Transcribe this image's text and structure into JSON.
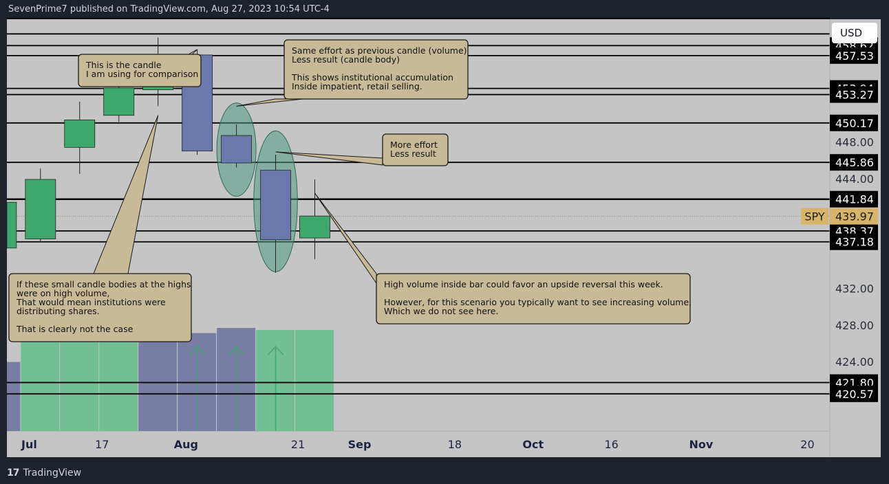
{
  "header": {
    "publish_line": "SevenPrime7 published on TradingView.com, Aug 27, 2023 10:54 UTC-4"
  },
  "footer": {
    "brand": "TradingView",
    "logo_glyph": "17"
  },
  "currency": "USD",
  "symbol_tag": {
    "text": "SPY",
    "price": "439.97"
  },
  "colors": {
    "background": "#c5c5c5",
    "frame": "#1e222d",
    "bull": "#3ea86c",
    "bear": "#6b78ac",
    "callout": "#c8ba96",
    "ellipse": "#4f9b85"
  },
  "chart_data": {
    "type": "candlestick",
    "symbol": "SPY",
    "ylim": [
      416.5,
      461.5
    ],
    "xlim": [
      "2023-06-30",
      "2023-11-24"
    ],
    "y_ticks": [
      "448.00",
      "444.00",
      "432.00",
      "428.00",
      "424.00"
    ],
    "x_ticks": [
      {
        "label": "Jul",
        "date": "2023-07-03"
      },
      {
        "label": "17",
        "date": "2023-07-17"
      },
      {
        "label": "Aug",
        "date": "2023-08-01"
      },
      {
        "label": "21",
        "date": "2023-08-21"
      },
      {
        "label": "Sep",
        "date": "2023-09-01"
      },
      {
        "label": "18",
        "date": "2023-09-18"
      },
      {
        "label": "Oct",
        "date": "2023-10-02"
      },
      {
        "label": "16",
        "date": "2023-10-16"
      },
      {
        "label": "Nov",
        "date": "2023-11-01"
      },
      {
        "label": "20",
        "date": "2023-11-20"
      }
    ],
    "level_labels": [
      "458.62",
      "457.53",
      "453.94",
      "453.27",
      "450.17",
      "445.86",
      "441.84",
      "438.37",
      "437.18",
      "421.80",
      "420.57"
    ],
    "horizontal_levels": [
      461.6,
      459.9,
      458.62,
      457.53,
      453.94,
      453.27,
      450.17,
      445.86,
      441.84,
      438.37,
      437.18,
      421.8,
      420.57
    ],
    "last_price": 439.97,
    "candles": [
      {
        "date": "2023-06-26",
        "open": 436.5,
        "high": 444.0,
        "low": 436.5,
        "close": 441.5
      },
      {
        "date": "2023-07-03",
        "open": 437.5,
        "high": 445.2,
        "low": 437.2,
        "close": 444.0
      },
      {
        "date": "2023-07-10",
        "open": 447.5,
        "high": 452.5,
        "low": 444.6,
        "close": 450.5
      },
      {
        "date": "2023-07-17",
        "open": 451.0,
        "high": 456.5,
        "low": 450.3,
        "close": 454.0
      },
      {
        "date": "2023-07-24",
        "open": 453.8,
        "high": 459.5,
        "low": 452.0,
        "close": 457.2
      },
      {
        "date": "2023-07-31",
        "open": 457.6,
        "high": 458.2,
        "low": 446.7,
        "close": 447.1
      },
      {
        "date": "2023-08-07",
        "open": 448.8,
        "high": 450.0,
        "low": 445.3,
        "close": 445.8
      },
      {
        "date": "2023-08-14",
        "open": 445.0,
        "high": 446.7,
        "low": 433.8,
        "close": 437.4
      },
      {
        "date": "2023-08-21",
        "open": 437.6,
        "high": 444.0,
        "low": 435.3,
        "close": 440.0
      }
    ],
    "volume": [
      {
        "date": "2023-06-26",
        "direction": "down",
        "relative": 0.67
      },
      {
        "date": "2023-07-03",
        "direction": "up",
        "relative": 0.91
      },
      {
        "date": "2023-07-10",
        "direction": "up",
        "relative": 0.91
      },
      {
        "date": "2023-07-17",
        "direction": "up",
        "relative": 0.91
      },
      {
        "date": "2023-07-24",
        "direction": "down",
        "relative": 0.94
      },
      {
        "date": "2023-07-31",
        "direction": "down",
        "relative": 0.95
      },
      {
        "date": "2023-08-07",
        "direction": "down",
        "relative": 1.0
      },
      {
        "date": "2023-08-14",
        "direction": "up",
        "relative": 0.98
      },
      {
        "date": "2023-08-21",
        "direction": "up",
        "relative": 0.98
      }
    ],
    "volume_arrows": [
      "2023-07-31",
      "2023-08-07",
      "2023-08-14"
    ],
    "ellipses": [
      {
        "center_date": "2023-08-07",
        "center_price": 447.25,
        "date_radius_days": 3.5,
        "price_radius": 5.1
      },
      {
        "center_date": "2023-08-14",
        "center_price": 441.6,
        "date_radius_days": 3.9,
        "price_radius": 7.7
      }
    ],
    "annotations": [
      {
        "id": "comparison-candle",
        "lines": [
          "This is the candle",
          "I am using for comparison"
        ],
        "pointer": {
          "date": "2023-07-31",
          "price": 458.2
        }
      },
      {
        "id": "same-effort",
        "lines": [
          "Same effort as previous candle (volume)",
          "Less result (candle body)",
          "",
          "This shows institutional accumulation",
          "Inside impatient, retail selling."
        ],
        "pointer": {
          "date": "2023-08-07",
          "price": 452.0
        }
      },
      {
        "id": "more-effort",
        "lines": [
          "More effort",
          "Less result"
        ],
        "pointer": {
          "date": "2023-08-14",
          "price": 447.0
        }
      },
      {
        "id": "inside-bar",
        "lines": [
          "High volume inside bar could favor an upside reversal this week.",
          "",
          "However, for this scenario you typically want to see increasing volume,",
          "Which we do not see here."
        ],
        "pointer": {
          "date": "2023-08-21",
          "price": 442.5
        }
      },
      {
        "id": "small-bodies",
        "lines": [
          "If these small candle bodies at the highs",
          "were on high volume,",
          "That would mean institutions were",
          "distributing shares.",
          "",
          "That is clearly not the case"
        ],
        "pointer": {
          "date": "2023-07-24",
          "price": 451.0
        }
      }
    ]
  }
}
